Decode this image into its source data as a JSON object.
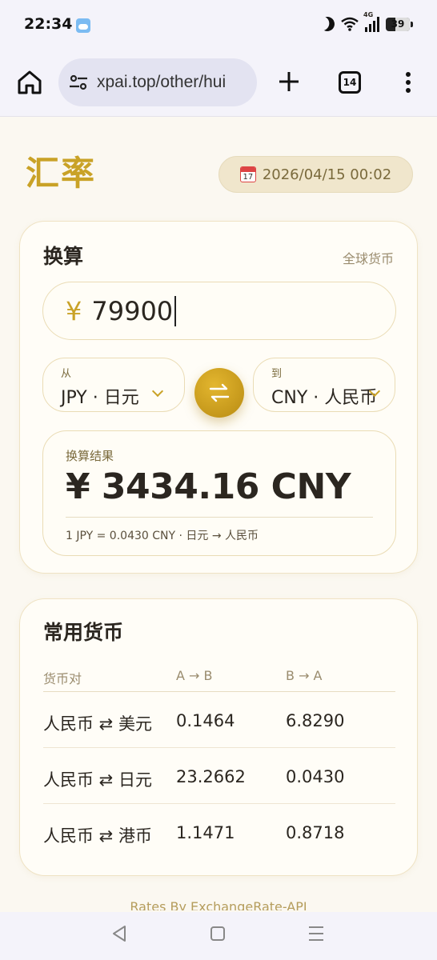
{
  "status": {
    "time": "22:34",
    "network": "4G",
    "battery": "39"
  },
  "browser": {
    "url": "xpai.top/other/hui",
    "tab_count": "14"
  },
  "header": {
    "title": "汇率",
    "date": "2026/04/15 00:02",
    "calendar_day": "17"
  },
  "converter": {
    "title": "换算",
    "global_link": "全球货币",
    "amount_symbol": "¥",
    "amount": "79900",
    "from_label": "从",
    "from_value": "JPY · 日元",
    "to_label": "到",
    "to_value": "CNY · 人民币",
    "result_label": "换算结果",
    "result_value": "¥ 3434.16 CNY",
    "rate_text": "1 JPY = 0.0430 CNY · 日元 → 人民币"
  },
  "common": {
    "title": "常用货币",
    "headers": [
      "货币对",
      "A → B",
      "B → A"
    ],
    "rows": [
      {
        "pair": "人民币 ⇄ 美元",
        "ab": "0.1464",
        "ba": "6.8290"
      },
      {
        "pair": "人民币 ⇄ 日元",
        "ab": "23.2662",
        "ba": "0.0430"
      },
      {
        "pair": "人民币 ⇄ 港币",
        "ab": "1.1471",
        "ba": "0.8718"
      }
    ]
  },
  "footer": {
    "note": "Rates By ExchangeRate-API"
  },
  "colors": {
    "accent": "#c9a227",
    "background": "#fbf8f1",
    "card": "#fffdf7"
  }
}
